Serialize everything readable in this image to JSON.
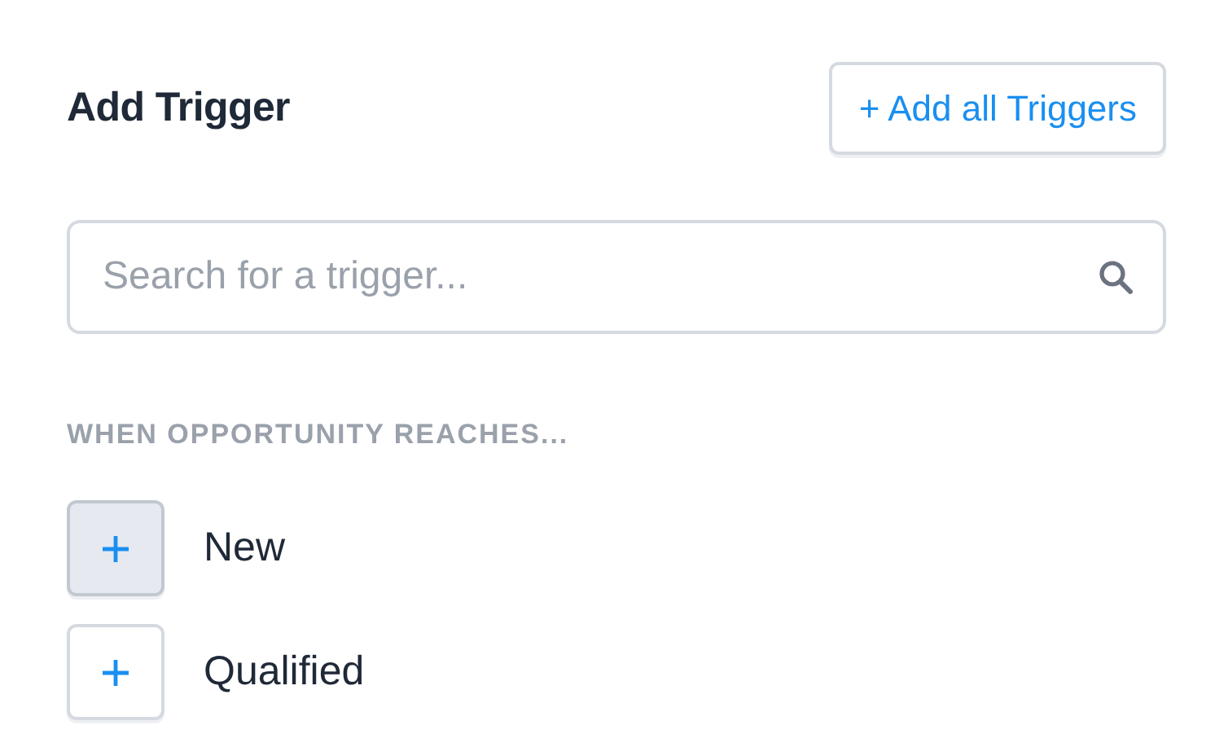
{
  "title": "Add Trigger",
  "add_all_button": {
    "label": "+ Add all Triggers"
  },
  "search": {
    "placeholder": "Search for a trigger..."
  },
  "section": {
    "heading": "WHEN OPPORTUNITY REACHES...",
    "items": [
      {
        "label": "New",
        "hovered": true
      },
      {
        "label": "Qualified",
        "hovered": false
      }
    ]
  }
}
